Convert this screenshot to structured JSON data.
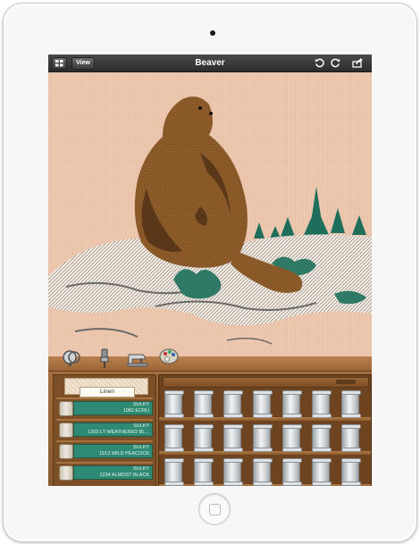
{
  "navbar": {
    "view_label": "View",
    "title": "Beaver",
    "icons": [
      "grid-icon",
      "undo-icon",
      "redo-icon",
      "share-icon"
    ]
  },
  "fabric": {
    "label": "Linen"
  },
  "threads": [
    {
      "brand": "SULKY",
      "name": "1082 ECRU",
      "color": "#2f8a73"
    },
    {
      "brand": "SULKY",
      "name": "1203 LT WEATHERED BL...",
      "color": "#2f8a73"
    },
    {
      "brand": "SULKY",
      "name": "1513 WILD PEACOCK",
      "color": "#2f8a73"
    },
    {
      "brand": "SULKY",
      "name": "1234 ALMOST BLACK",
      "color": "#2f8a73"
    }
  ],
  "toolbar_icons": [
    "hoop-icon",
    "needle-icon",
    "sewing-machine-icon",
    "palette-icon"
  ],
  "colors": {
    "canvas": "#ecc6ad",
    "wood": "#9b6434",
    "navbar": "#2c2c2c",
    "thread_tag": "#2f8a73"
  }
}
